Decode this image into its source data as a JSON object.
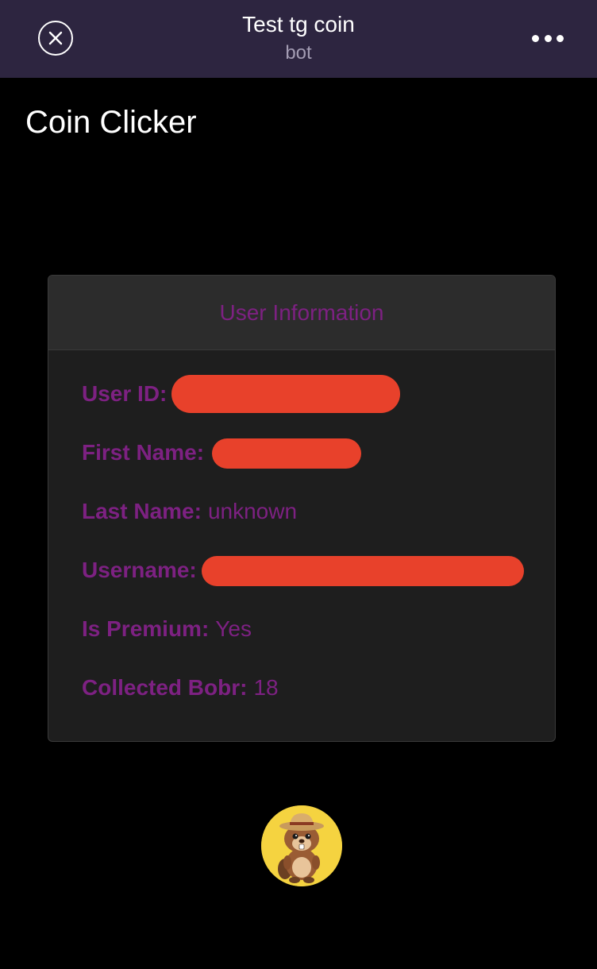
{
  "header": {
    "title": "Test tg coin",
    "subtitle": "bot",
    "close_icon": "close-icon",
    "more_icon": "more-dots-icon"
  },
  "page": {
    "heading": "Coin Clicker"
  },
  "user_card": {
    "title": "User Information",
    "fields": [
      {
        "label": "User ID:",
        "value": null,
        "redacted": true
      },
      {
        "label": "First Name:",
        "value": null,
        "redacted": true
      },
      {
        "label": "Last Name:",
        "value": "unknown",
        "redacted": false
      },
      {
        "label": "Username:",
        "value": null,
        "redacted": true
      },
      {
        "label": "Is Premium:",
        "value": "Yes",
        "redacted": false
      },
      {
        "label": "Collected Bobr:",
        "value": "18",
        "redacted": false
      }
    ]
  },
  "coin": {
    "icon": "beaver-coin-icon"
  },
  "colors": {
    "topbar_bg": "#2d2540",
    "accent_purple": "#7d2182",
    "redaction": "#e8412b",
    "coin_yellow": "#f5d340"
  }
}
